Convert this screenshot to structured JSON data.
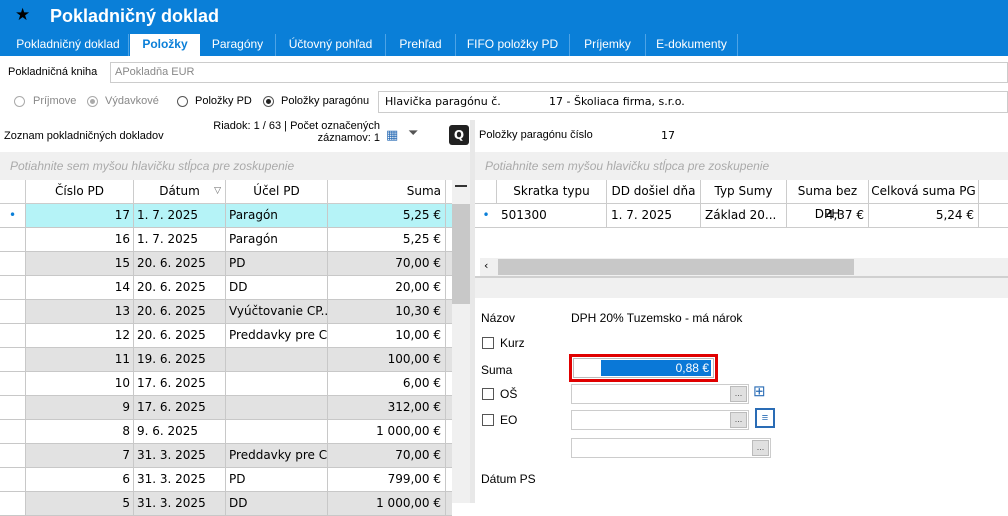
{
  "window": {
    "title": "Pokladničný doklad"
  },
  "tabs": [
    {
      "label": "Pokladničný doklad"
    },
    {
      "label": "Položky"
    },
    {
      "label": "Paragóny"
    },
    {
      "label": "Účtovný pohľad"
    },
    {
      "label": "Prehľad"
    },
    {
      "label": "FIFO položky PD"
    },
    {
      "label": "Príjemky"
    },
    {
      "label": "E-dokumenty"
    }
  ],
  "kniha": {
    "label": "Pokladničná kniha",
    "value": "APokladňa EUR"
  },
  "options": {
    "prijmove": "Príjmove",
    "vydavkove": "Výdavkové",
    "polozky_pd": "Položky PD",
    "polozky_paragonu": "Položky paragónu",
    "hlavicka_label": "Hlavička paragónu č.",
    "hlavicka_value": "17 - Školiaca firma, s.r.o."
  },
  "left": {
    "title": "Zoznam pokladničných dokladov",
    "info_line1": "Riadok: 1 / 63 | Počet označených",
    "info_line2": "záznamov: 1",
    "group_hint": "Potiahnite sem myšou hlavičku stĺpca pre zoskupenie",
    "columns": [
      "Číslo PD",
      "Dátum",
      "Účel PD",
      "Suma"
    ],
    "rows": [
      {
        "cislo": "17",
        "datum": "1. 7. 2025",
        "ucel": "Paragón",
        "suma": "5,25 €"
      },
      {
        "cislo": "16",
        "datum": "1. 7. 2025",
        "ucel": "Paragón",
        "suma": "5,25 €"
      },
      {
        "cislo": "15",
        "datum": "20. 6. 2025",
        "ucel": "PD",
        "suma": "70,00 €"
      },
      {
        "cislo": "14",
        "datum": "20. 6. 2025",
        "ucel": "DD",
        "suma": "20,00 €"
      },
      {
        "cislo": "13",
        "datum": "20. 6. 2025",
        "ucel": "Vyúčtovanie CP...",
        "suma": "10,30 €"
      },
      {
        "cislo": "12",
        "datum": "20. 6. 2025",
        "ucel": "Preddavky pre C...",
        "suma": "10,00 €"
      },
      {
        "cislo": "11",
        "datum": "19. 6. 2025",
        "ucel": "",
        "suma": "100,00 €"
      },
      {
        "cislo": "10",
        "datum": "17. 6. 2025",
        "ucel": "",
        "suma": "6,00 €"
      },
      {
        "cislo": "9",
        "datum": "17. 6. 2025",
        "ucel": "",
        "suma": "312,00 €"
      },
      {
        "cislo": "8",
        "datum": "9. 6. 2025",
        "ucel": "",
        "suma": "1 000,00 €"
      },
      {
        "cislo": "7",
        "datum": "31. 3. 2025",
        "ucel": "Preddavky pre C...",
        "suma": "70,00 €"
      },
      {
        "cislo": "6",
        "datum": "31. 3. 2025",
        "ucel": "PD",
        "suma": "799,00 €"
      },
      {
        "cislo": "5",
        "datum": "31. 3. 2025",
        "ucel": "DD",
        "suma": "1 000,00 €"
      }
    ]
  },
  "right": {
    "title": "Položky paragónu číslo",
    "number": "17",
    "group_hint": "Potiahnite sem myšou hlavičku stĺpca pre zoskupenie",
    "columns": [
      "Skratka typu",
      "DD došiel dňa",
      "Typ Sumy",
      "Suma bez DPH",
      "Celková suma PG"
    ],
    "rows": [
      {
        "skratka": "501300",
        "dd": "1. 7. 2025",
        "typ": "Základ 20...",
        "bez_dph": "4,37 €",
        "celkova": "5,24 €"
      }
    ]
  },
  "detail": {
    "nazov_label": "Názov",
    "nazov_value": "DPH 20% Tuzemsko  - má nárok",
    "kurz_label": "Kurz",
    "suma_label": "Suma",
    "suma_value": "0,88 €",
    "os_label": "OŠ",
    "eo_label": "EO",
    "datum_ps_label": "Dátum PS",
    "highlight_color": "#e00000",
    "selection_color": "#0a78d7"
  }
}
